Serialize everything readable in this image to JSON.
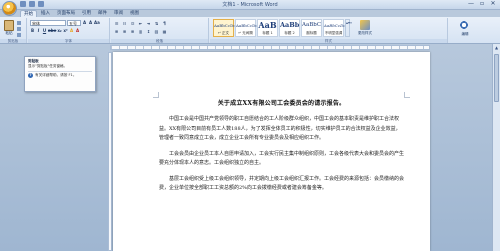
{
  "window": {
    "title": "文档1 - Microsoft Word",
    "controls": [
      "—",
      "▫",
      "✕"
    ]
  },
  "tabs": [
    "开始",
    "插入",
    "页面布局",
    "引用",
    "邮件",
    "审阅",
    "视图"
  ],
  "ribbon": {
    "clipboard": {
      "paste_label": "粘贴",
      "group_label": "剪贴板"
    },
    "font": {
      "font_name": "宋体",
      "font_size": "五号",
      "buttons": [
        "A",
        "A",
        "Aa",
        "B",
        "I",
        "U",
        "abe",
        "x₂",
        "x²",
        "A",
        "A"
      ],
      "group_label": "字体"
    },
    "paragraph": {
      "group_label": "段落"
    },
    "styles": {
      "items": [
        {
          "sample": "AaBbCcDc",
          "name": "↵ 正文"
        },
        {
          "sample": "AaBbCcDc",
          "name": "↵ 无间隔"
        },
        {
          "sample": "AaB",
          "name": "标题 1"
        },
        {
          "sample": "AaBb",
          "name": "标题 2"
        },
        {
          "sample": "AaBbC",
          "name": "副标题"
        },
        {
          "sample": "AaBbCcDc",
          "name": "不明显强调"
        }
      ],
      "change_styles": "更改样式",
      "group_label": "样式"
    },
    "editing": {
      "label": "编辑"
    }
  },
  "tooltip": {
    "title": "剪贴板",
    "body": "显示\"剪贴板\"任务窗格。",
    "help": "有关详细帮助，请按 F1。"
  },
  "document": {
    "title": "关于成立XX有限公司工会委员会的请示报告。",
    "paragraphs": [
      "中国工会是中国共产党领导的职工自愿结合的工人阶级群众组织，中国工会的基本职责是维护职工合法权益。XX有限公司目前有员工人数188人，为了发挥全体员工的积极性，切实维护员工的合法权益及企业效益，管理者一致同意成立工会，成立企业工会所有专业委员会及相应组织工作。",
      "工会会员由企业员工本人自愿申请加入，工会实行民主集中制组织原则，工会各级代表大会和委员会的产生要充分体现本人的意志。工会组织独立的自主。",
      "基层工会组织受上级工会组织领导，并定期向上级工会组织汇报工作。工会经费的来源包括：会员缴纳的会费，企业单位按全部职工工资总额的2%向工会拨缴经费或者建会筹备金等。"
    ]
  }
}
